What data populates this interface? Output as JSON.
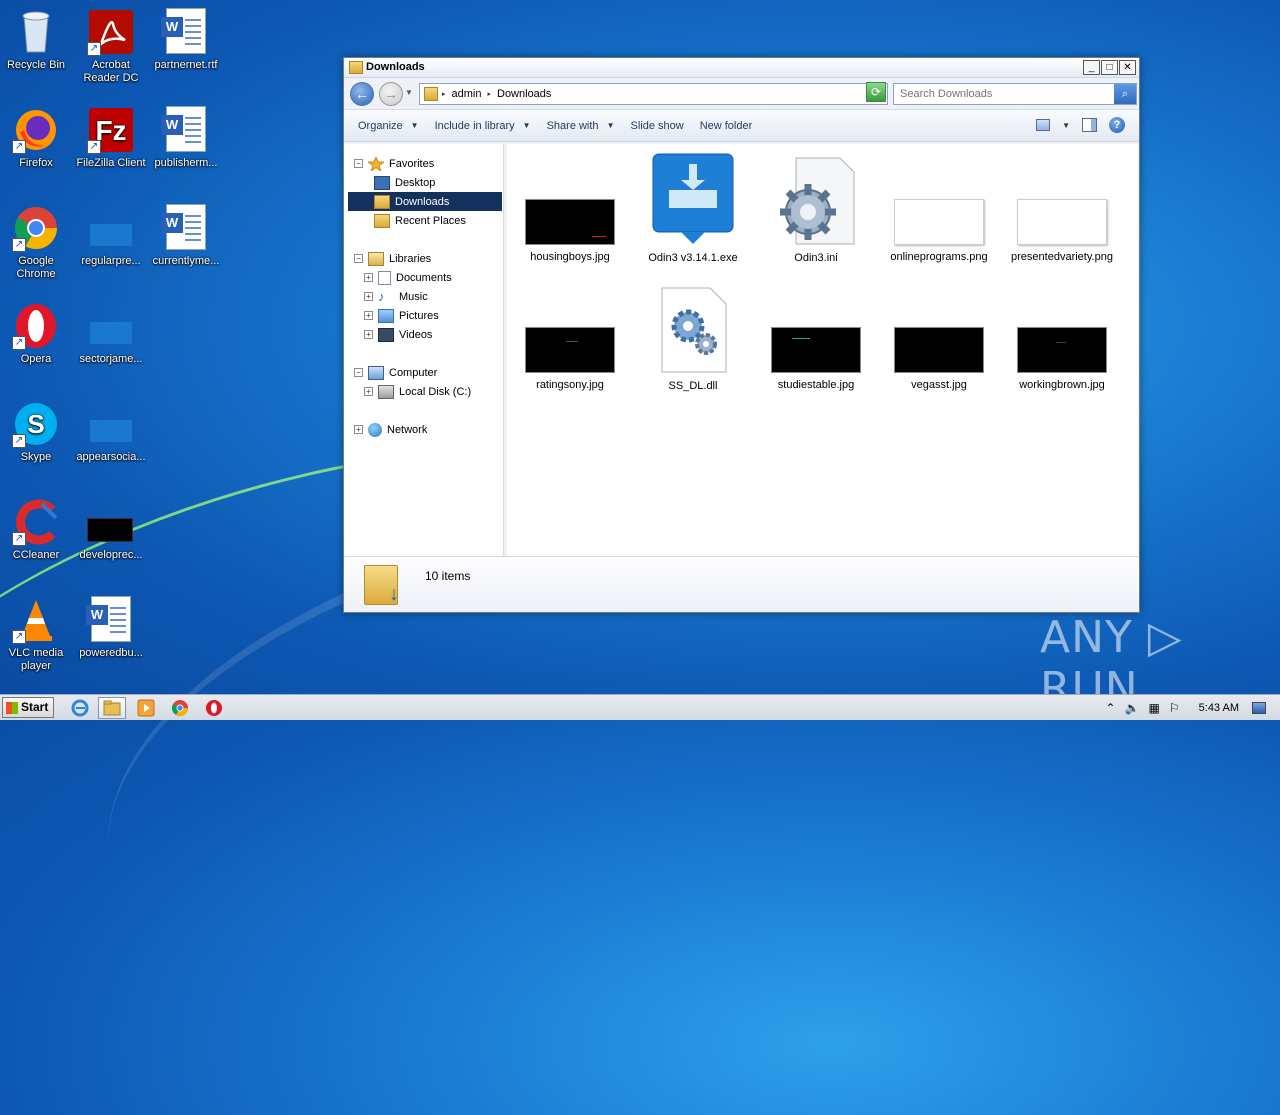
{
  "desktop": {
    "icons": [
      {
        "label": "Recycle Bin"
      },
      {
        "label": "Acrobat Reader DC"
      },
      {
        "label": "partnernet.rtf"
      },
      {
        "label": "Firefox"
      },
      {
        "label": "FileZilla Client"
      },
      {
        "label": "publisherm..."
      },
      {
        "label": "Google Chrome"
      },
      {
        "label": "regularpre..."
      },
      {
        "label": "currentlyme..."
      },
      {
        "label": "Opera"
      },
      {
        "label": "sectorjame..."
      },
      {
        "label": "Skype"
      },
      {
        "label": "appearsocia..."
      },
      {
        "label": "CCleaner"
      },
      {
        "label": "developrec..."
      },
      {
        "label": "VLC media player"
      },
      {
        "label": "poweredbu..."
      }
    ],
    "watermark": "ANY ▷ RUN"
  },
  "window": {
    "title": "Downloads",
    "controls": {
      "minimize": "_",
      "maximize": "□",
      "close": "✕"
    },
    "breadcrumb": [
      "admin",
      "Downloads"
    ],
    "search_placeholder": "Search Downloads",
    "toolbar": {
      "organize": "Organize",
      "include_in_library": "Include in library",
      "share_with": "Share with",
      "slide_show": "Slide show",
      "new_folder": "New folder"
    },
    "nav": {
      "favorites": "Favorites",
      "desktop": "Desktop",
      "downloads": "Downloads",
      "recent_places": "Recent Places",
      "libraries": "Libraries",
      "documents": "Documents",
      "music": "Music",
      "pictures": "Pictures",
      "videos": "Videos",
      "computer": "Computer",
      "local_disk": "Local Disk (C:)",
      "network": "Network"
    },
    "files": [
      {
        "name": "housingboys.jpg"
      },
      {
        "name": "Odin3 v3.14.1.exe"
      },
      {
        "name": "Odin3.ini"
      },
      {
        "name": "onlineprograms.png"
      },
      {
        "name": "presentedvariety.png"
      },
      {
        "name": "ratingsony.jpg"
      },
      {
        "name": "SS_DL.dll"
      },
      {
        "name": "studiestable.jpg"
      },
      {
        "name": "vegasst.jpg"
      },
      {
        "name": "workingbrown.jpg"
      }
    ],
    "status": {
      "item_count": "10 items"
    }
  },
  "taskbar": {
    "start_label": "Start",
    "clock": "5:43 AM"
  },
  "colors": {
    "desktop_blue": "#1a7bd1",
    "selection_navy": "#13315c",
    "window_border": "#6a7b92"
  }
}
